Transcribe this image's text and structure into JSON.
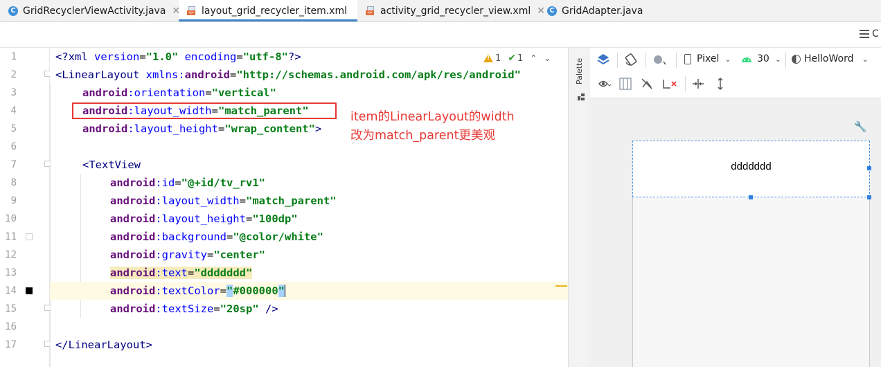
{
  "tabs": [
    {
      "label": "GridRecyclerViewActivity.java",
      "icon": "class-c-icon",
      "active": false
    },
    {
      "label": "layout_grid_recycler_item.xml",
      "icon": "xml-layout-icon",
      "active": true
    },
    {
      "label": "activity_grid_recycler_view.xml",
      "icon": "xml-layout-icon",
      "active": false
    },
    {
      "label": "GridAdapter.java",
      "icon": "class-c-icon",
      "active": false
    }
  ],
  "tab_close_glyph": "✕",
  "toolbar": {
    "cut_label": "C"
  },
  "line_numbers": [
    "1",
    "2",
    "3",
    "4",
    "5",
    "6",
    "7",
    "8",
    "9",
    "10",
    "11",
    "12",
    "13",
    "14",
    "15",
    "16",
    "17"
  ],
  "code": {
    "l1": {
      "p1": "<?",
      "p2": "xml ",
      "p3": "version",
      "p4": "=",
      "p5": "\"1.0\"",
      "p6": " encoding",
      "p7": "=",
      "p8": "\"utf-8\"",
      "p9": "?>"
    },
    "l2": {
      "p1": "<LinearLayout ",
      "p2": "xmlns:",
      "p3": "android",
      "p4": "=",
      "p5": "\"http://schemas.android.com/apk/res/android\""
    },
    "l3": {
      "ns": "android",
      "attr": ":orientation",
      "eq": "=",
      "val": "\"vertical\""
    },
    "l4": {
      "ns": "android",
      "attr": ":layout_width",
      "eq": "=",
      "val": "\"match_parent\""
    },
    "l5": {
      "ns": "android",
      "attr": ":layout_height",
      "eq": "=",
      "val": "\"wrap_content\"",
      "end": ">"
    },
    "l7": {
      "tag": "<TextView"
    },
    "l8": {
      "ns": "android",
      "attr": ":id",
      "eq": "=",
      "val": "\"@+id/tv_rv1\""
    },
    "l9": {
      "ns": "android",
      "attr": ":layout_width",
      "eq": "=",
      "val": "\"match_parent\""
    },
    "l10": {
      "ns": "android",
      "attr": ":layout_height",
      "eq": "=",
      "val": "\"100dp\""
    },
    "l11": {
      "ns": "android",
      "attr": ":background",
      "eq": "=",
      "val": "\"@color/white\""
    },
    "l12": {
      "ns": "android",
      "attr": ":gravity",
      "eq": "=",
      "val": "\"center\""
    },
    "l13": {
      "ns": "android",
      "attr": ":text",
      "eq": "=",
      "val": "\"ddddddd\""
    },
    "l14": {
      "ns": "android",
      "attr": ":textColor",
      "eq": "=",
      "q1": "\"",
      "val": "#000000",
      "q2": "\""
    },
    "l15": {
      "ns": "android",
      "attr": ":textSize",
      "eq": "=",
      "val": "\"20sp\"",
      "end": " />"
    },
    "l17": {
      "tag": "</LinearLayout>"
    }
  },
  "inspections": {
    "warnings": "1",
    "weak_warnings": "1"
  },
  "annotation": {
    "line1": "item的LinearLayout的width",
    "line2": "改为match_parent更美观"
  },
  "palette_label": "Palette",
  "design_toolbar": {
    "device": "Pixel",
    "api": "30",
    "theme": "HelloWord"
  },
  "preview": {
    "item_text": "ddddddd"
  },
  "colors": {
    "accent_tab": "#4083c9",
    "annotation_red": "#e53935",
    "string_green": "#067d17",
    "namespace_purple": "#660e7a"
  }
}
